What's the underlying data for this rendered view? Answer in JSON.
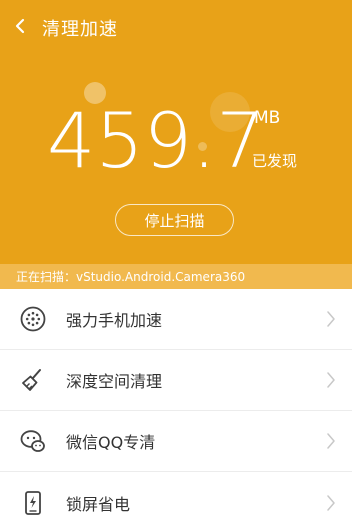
{
  "header": {
    "title": "清理加速",
    "back_icon": "chevron-left-icon"
  },
  "colors": {
    "hero_bg": "#e8a218",
    "scan_bar_bg": "#f1b94e",
    "text_dark": "#333333",
    "icon_gray": "#444444",
    "chevron_gray": "#c8c8c8"
  },
  "summary": {
    "value": "459.7",
    "unit": "MB",
    "status": "已发现"
  },
  "stop_button": {
    "label": "停止扫描"
  },
  "scan_status": {
    "text": "正在扫描：vStudio.Android.Camera360"
  },
  "menu": [
    {
      "label": "强力手机加速",
      "icon": "fan-icon"
    },
    {
      "label": "深度空间清理",
      "icon": "broom-icon"
    },
    {
      "label": "微信QQ专清",
      "icon": "chat-icon"
    },
    {
      "label": "锁屏省电",
      "icon": "battery-lock-icon"
    }
  ]
}
